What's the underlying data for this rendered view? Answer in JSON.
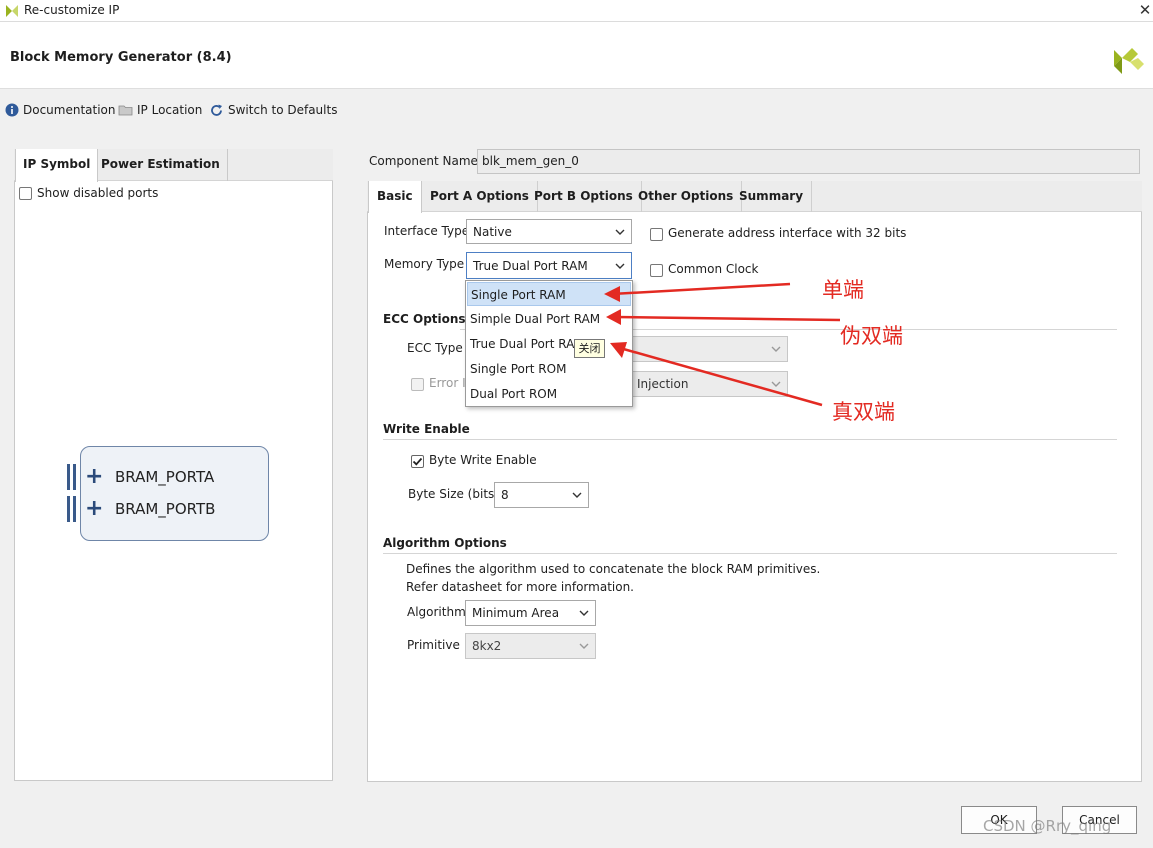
{
  "window": {
    "title": "Re-customize IP",
    "close_glyph": "✕"
  },
  "header": {
    "ip_title": "Block Memory Generator (8.4)"
  },
  "toolbar": {
    "documentation": "Documentation",
    "ip_location": "IP Location",
    "switch_defaults": "Switch to Defaults"
  },
  "left_panel": {
    "tabs": [
      {
        "label": "IP Symbol",
        "active": true
      },
      {
        "label": "Power Estimation",
        "active": false
      }
    ],
    "show_disabled_ports": {
      "label": "Show disabled ports",
      "checked": false
    },
    "ports": [
      {
        "label": "BRAM_PORTA"
      },
      {
        "label": "BRAM_PORTB"
      }
    ]
  },
  "component_name": {
    "label": "Component Name",
    "value": "blk_mem_gen_0"
  },
  "right_panel": {
    "tabs": [
      {
        "label": "Basic",
        "active": true
      },
      {
        "label": "Port A Options",
        "active": false
      },
      {
        "label": "Port B Options",
        "active": false
      },
      {
        "label": "Other Options",
        "active": false
      },
      {
        "label": "Summary",
        "active": false
      }
    ],
    "interface_type": {
      "label": "Interface Type",
      "value": "Native"
    },
    "memory_type": {
      "label": "Memory Type",
      "value": "True Dual Port RAM"
    },
    "gen_addr_32": {
      "label": "Generate address interface with 32 bits",
      "checked": false
    },
    "common_clock": {
      "label": "Common Clock",
      "checked": false
    },
    "ecc": {
      "title": "ECC Options",
      "ecc_type_label": "ECC Type",
      "error_injection_label": "Error I",
      "injection_value": "Injection"
    },
    "write_enable": {
      "title": "Write Enable",
      "byte_write_enable": {
        "label": "Byte Write Enable",
        "checked": true
      },
      "byte_size": {
        "label": "Byte Size (bits)",
        "value": "8"
      }
    },
    "algorithm": {
      "title": "Algorithm Options",
      "desc1": "Defines the algorithm used to concatenate the block RAM primitives.",
      "desc2": "Refer datasheet for more information.",
      "algorithm_label": "Algorithm",
      "algorithm_value": "Minimum Area",
      "primitive_label": "Primitive",
      "primitive_value": "8kx2"
    }
  },
  "dropdown": {
    "options": [
      {
        "label": "Single Port RAM",
        "highlighted": true
      },
      {
        "label": "Simple Dual Port RAM",
        "highlighted": false
      },
      {
        "label": "True Dual Port RAM",
        "highlighted": false
      },
      {
        "label": "Single Port ROM",
        "highlighted": false
      },
      {
        "label": "Dual Port ROM",
        "highlighted": false
      }
    ],
    "tooltip": "关闭"
  },
  "annotations": {
    "single": "单端",
    "pseudo_dual": "伪双端",
    "true_dual": "真双端",
    "color": "#e32a22"
  },
  "buttons": {
    "ok": "OK",
    "cancel": "Cancel"
  },
  "watermark": "CSDN @Rry_qing",
  "colors": {
    "accent_blue": "#4d7fc4",
    "logo_green": "#9ab31f"
  }
}
